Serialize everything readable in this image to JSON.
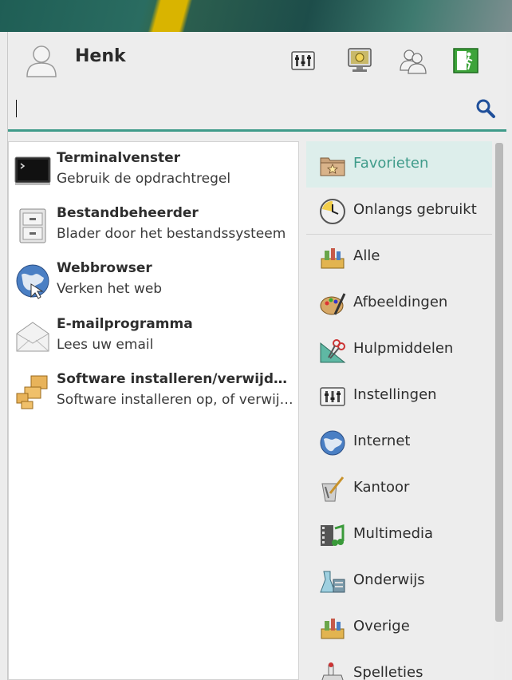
{
  "user": {
    "name": "Henk"
  },
  "header_buttons": [
    {
      "name": "settings-icon"
    },
    {
      "name": "lock-screen-icon"
    },
    {
      "name": "switch-user-icon"
    },
    {
      "name": "logout-icon"
    }
  ],
  "search": {
    "value": "",
    "placeholder": ""
  },
  "apps": [
    {
      "name": "Terminalvenster",
      "desc": "Gebruik de opdrachtregel",
      "icon": "terminal-icon"
    },
    {
      "name": "Bestandbeheerder",
      "desc": "Blader door het bestandssysteem",
      "icon": "file-manager-icon"
    },
    {
      "name": "Webbrowser",
      "desc": "Verken het web",
      "icon": "web-browser-icon"
    },
    {
      "name": "E-mailprogramma",
      "desc": "Lees uw email",
      "icon": "mail-icon"
    },
    {
      "name": "Software installeren/verwijderen",
      "desc": "Software installeren op,  of verwijderen van uw systeem",
      "icon": "software-icon"
    }
  ],
  "categories": [
    {
      "label": "Favorieten",
      "icon": "favorites-icon",
      "active": true
    },
    {
      "label": "Onlangs gebruikt",
      "icon": "recent-icon"
    },
    {
      "label": "Alle",
      "icon": "all-icon"
    },
    {
      "label": "Afbeeldingen",
      "icon": "graphics-icon"
    },
    {
      "label": "Hulpmiddelen",
      "icon": "accessories-icon"
    },
    {
      "label": "Instellingen",
      "icon": "settings-icon"
    },
    {
      "label": "Internet",
      "icon": "internet-icon"
    },
    {
      "label": "Kantoor",
      "icon": "office-icon"
    },
    {
      "label": "Multimedia",
      "icon": "multimedia-icon"
    },
    {
      "label": "Onderwijs",
      "icon": "education-icon"
    },
    {
      "label": "Overige",
      "icon": "other-icon"
    },
    {
      "label": "Spelleties",
      "icon": "games-icon"
    }
  ],
  "colors": {
    "accent": "#3f9b8a",
    "active_bg": "#ddeeeb"
  }
}
